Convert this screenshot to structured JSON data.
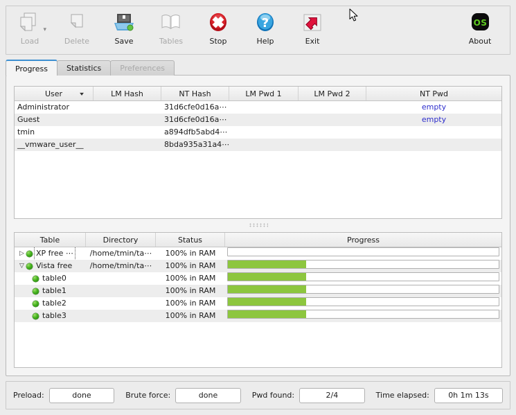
{
  "toolbar": {
    "items": [
      {
        "label": "Load",
        "icon": "load-icon",
        "disabled": true,
        "caret": true
      },
      {
        "label": "Delete",
        "icon": "delete-icon",
        "disabled": true,
        "caret": false
      },
      {
        "label": "Save",
        "icon": "save-icon",
        "disabled": false,
        "caret": false
      },
      {
        "label": "Tables",
        "icon": "tables-icon",
        "disabled": true,
        "caret": false
      },
      {
        "label": "Stop",
        "icon": "stop-icon",
        "disabled": false,
        "caret": false
      },
      {
        "label": "Help",
        "icon": "help-icon",
        "disabled": false,
        "caret": false
      },
      {
        "label": "Exit",
        "icon": "exit-icon",
        "disabled": false,
        "caret": false
      }
    ],
    "about": {
      "label": "About",
      "icon": "about-os-icon",
      "badge": "OS"
    }
  },
  "tabs": [
    {
      "label": "Progress",
      "active": true,
      "disabled": false
    },
    {
      "label": "Statistics",
      "active": false,
      "disabled": false
    },
    {
      "label": "Preferences",
      "active": false,
      "disabled": true
    }
  ],
  "users_table": {
    "columns": [
      "User",
      "LM Hash",
      "NT Hash",
      "LM Pwd 1",
      "LM Pwd 2",
      "NT Pwd"
    ],
    "sorted_column": "User",
    "sort_indicator": "chevron-down",
    "rows": [
      {
        "user": "Administrator",
        "lm_hash": "",
        "nt_hash": "31d6cfe0d16a⋯",
        "lm_pwd_1": "",
        "lm_pwd_2": "",
        "nt_pwd": "empty"
      },
      {
        "user": "Guest",
        "lm_hash": "",
        "nt_hash": "31d6cfe0d16a⋯",
        "lm_pwd_1": "",
        "lm_pwd_2": "",
        "nt_pwd": "empty"
      },
      {
        "user": "tmin",
        "lm_hash": "",
        "nt_hash": "a894dfb5abd4⋯",
        "lm_pwd_1": "",
        "lm_pwd_2": "",
        "nt_pwd": ""
      },
      {
        "user": "__vmware_user__",
        "lm_hash": "",
        "nt_hash": "8bda935a31a4⋯",
        "lm_pwd_1": "",
        "lm_pwd_2": "",
        "nt_pwd": ""
      }
    ]
  },
  "tables_table": {
    "columns": [
      "Table",
      "Directory",
      "Status",
      "Progress"
    ],
    "rows": [
      {
        "name": "XP free ⋯",
        "directory": "/home/tmin/ta⋯",
        "status": "100% in RAM",
        "progress": 0,
        "level": 0,
        "arrow": "collapsed",
        "focused": true
      },
      {
        "name": "Vista free",
        "directory": "/home/tmin/ta⋯",
        "status": "100% in RAM",
        "progress": 29,
        "level": 0,
        "arrow": "expanded",
        "focused": false
      },
      {
        "name": "table0",
        "directory": "",
        "status": "100% in RAM",
        "progress": 29,
        "level": 1,
        "arrow": "none",
        "focused": false
      },
      {
        "name": "table1",
        "directory": "",
        "status": "100% in RAM",
        "progress": 29,
        "level": 1,
        "arrow": "none",
        "focused": false
      },
      {
        "name": "table2",
        "directory": "",
        "status": "100% in RAM",
        "progress": 29,
        "level": 1,
        "arrow": "none",
        "focused": false
      },
      {
        "name": "table3",
        "directory": "",
        "status": "100% in RAM",
        "progress": 29,
        "level": 1,
        "arrow": "none",
        "focused": false
      }
    ]
  },
  "statusbar": {
    "preload_label": "Preload:",
    "preload_value": "done",
    "brute_label": "Brute force:",
    "brute_value": "done",
    "pwd_found_label": "Pwd found:",
    "pwd_found_value": "2/4",
    "time_label": "Time elapsed:",
    "time_value": "0h 1m 13s"
  },
  "colors": {
    "progress_fill": "#8dc63f",
    "active_tab_accent": "#3d8fd1",
    "found_pwd_text": "#2e2ecc",
    "window_bg": "#ececec",
    "panel_bg": "#f4f4f4"
  }
}
